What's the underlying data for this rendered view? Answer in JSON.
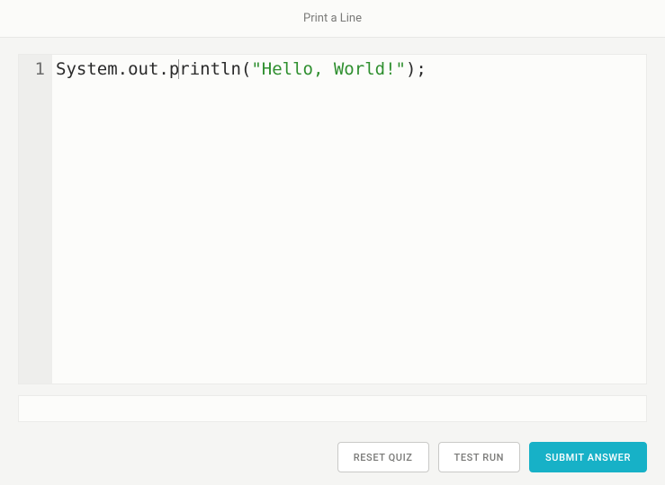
{
  "header": {
    "title": "Print a Line"
  },
  "editor": {
    "line_number": "1",
    "code_tokens": [
      {
        "cls": "tok-plain",
        "text": "System.out.p"
      },
      {
        "cursor": true
      },
      {
        "cls": "tok-plain",
        "text": "rintln("
      },
      {
        "cls": "tok-string",
        "text": "\"Hello, World!\""
      },
      {
        "cls": "tok-plain",
        "text": ");"
      }
    ]
  },
  "buttons": {
    "reset": "RESET QUIZ",
    "test": "TEST RUN",
    "submit": "SUBMIT ANSWER"
  }
}
